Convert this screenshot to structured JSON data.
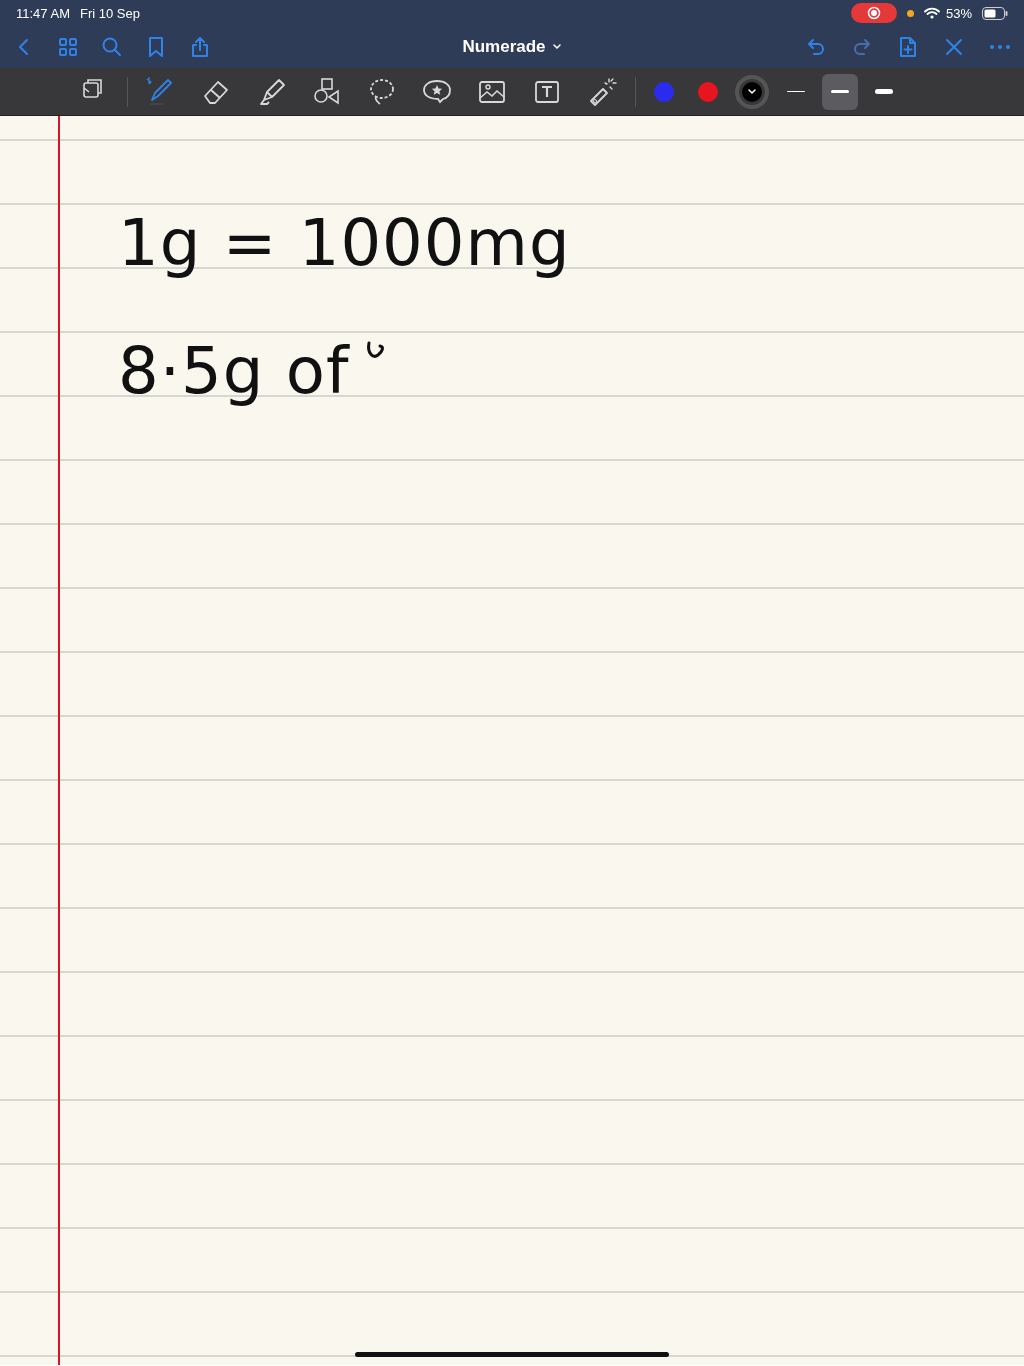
{
  "status_bar": {
    "time": "11:47 AM",
    "date": "Fri 10 Sep",
    "recording": true,
    "battery": "53%"
  },
  "nav": {
    "title": "Numerade"
  },
  "tools": [
    {
      "kind": "page",
      "selected": false
    },
    {
      "kind": "pen",
      "selected": true
    },
    {
      "kind": "eraser",
      "selected": false
    },
    {
      "kind": "highlighter",
      "selected": false
    },
    {
      "kind": "shapes",
      "selected": false
    },
    {
      "kind": "lasso",
      "selected": false
    },
    {
      "kind": "sticker",
      "selected": false
    },
    {
      "kind": "image",
      "selected": false
    },
    {
      "kind": "textbox",
      "selected": false
    },
    {
      "kind": "laser",
      "selected": false
    }
  ],
  "colors": [
    {
      "color": "#2b2bf0",
      "selected": false
    },
    {
      "color": "#e8141e",
      "selected": false
    },
    {
      "color": "#000000",
      "selected": true
    }
  ],
  "widths": [
    {
      "kind": "thin",
      "selected": false
    },
    {
      "kind": "medium",
      "selected": true
    },
    {
      "kind": "thick",
      "selected": false
    }
  ],
  "note": {
    "lines": [
      "1g = 1000mg",
      "8·5g of"
    ]
  }
}
